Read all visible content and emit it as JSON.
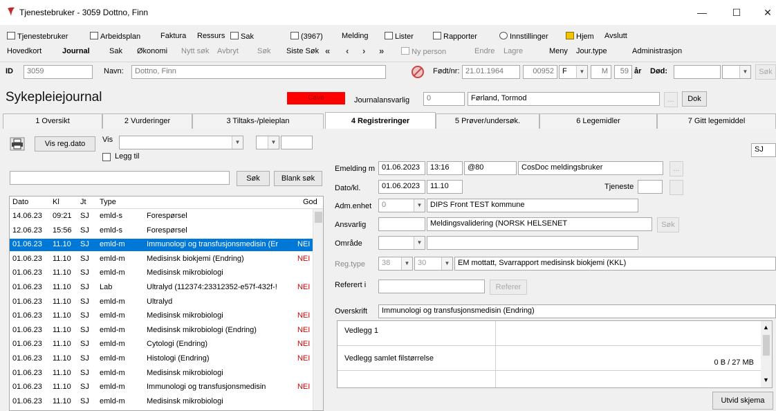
{
  "window": {
    "title": "Tjenestebruker - 3059 Dottno, Finn",
    "minimize": "—",
    "maximize": "☐",
    "close": "✕"
  },
  "menu": {
    "row1": [
      "Tjenestebruker",
      "Arbeidsplan",
      "Faktura",
      "Ressurs",
      "Sak",
      "(3967)",
      "Melding",
      "Lister",
      "Rapporter",
      "Innstillinger",
      "Hjem",
      "Avslutt"
    ],
    "row2": [
      "Hovedkort",
      "Journal",
      "Sak",
      "Økonomi",
      "Nytt søk",
      "Avbryt",
      "Søk",
      "Siste Søk",
      "Ny person",
      "Endre",
      "Lagre",
      "Meny",
      "Jour.type",
      "Administrasjon"
    ],
    "nav": [
      "«",
      "‹",
      "›",
      "»"
    ]
  },
  "person": {
    "id_label": "ID",
    "id_value": "3059",
    "name_label": "Navn:",
    "name_value": "Dottno, Finn",
    "fodt_label": "Født/nr:",
    "fodt_date": "21.01.1964",
    "fodt_nr": "00952",
    "kjonn": "F",
    "m": "M",
    "alder": "59",
    "ar_label": "år",
    "dod_label": "Død:",
    "sok_label": "Søk"
  },
  "journal": {
    "heading": "Sykepleiejournal",
    "cave": "Cave",
    "ansvarlig_label": "Journalansvarlig",
    "ansvarlig_id": "0",
    "ansvarlig_name": "Førland, Tormod",
    "ellipsis": "...",
    "dok": "Dok"
  },
  "tabs": [
    {
      "label": "1 Oversikt"
    },
    {
      "label": "2 Vurderinger"
    },
    {
      "label": "3 Tiltaks-/pleieplan"
    },
    {
      "label": "4 Registreringer"
    },
    {
      "label": "5 Prøver/undersøk."
    },
    {
      "label": "6 Legemidler"
    },
    {
      "label": "7 Gitt legemiddel"
    }
  ],
  "left": {
    "vis_reg_dato": "Vis reg.dato",
    "vis_label": "Vis",
    "legg_til": "Legg til",
    "sok": "Søk",
    "blank_sok": "Blank søk",
    "columns": [
      "Dato",
      "Kl",
      "Jt",
      "Type",
      "",
      "God"
    ],
    "rows": [
      {
        "dato": "14.06.23",
        "kl": "09:21",
        "jt": "SJ",
        "type": "emld-s",
        "desc": "Forespørsel",
        "nei": ""
      },
      {
        "dato": "12.06.23",
        "kl": "15:56",
        "jt": "SJ",
        "type": "emld-s",
        "desc": "Forespørsel",
        "nei": ""
      },
      {
        "dato": "01.06.23",
        "kl": "11.10",
        "jt": "SJ",
        "type": "emld-m",
        "desc": "Immunologi og transfusjonsmedisin (Er",
        "nei": "NEI"
      },
      {
        "dato": "01.06.23",
        "kl": "11.10",
        "jt": "SJ",
        "type": "emld-m",
        "desc": "Medisinsk biokjemi (Endring)",
        "nei": "NEI"
      },
      {
        "dato": "01.06.23",
        "kl": "11.10",
        "jt": "SJ",
        "type": "emld-m",
        "desc": "Medisinsk mikrobiologi",
        "nei": ""
      },
      {
        "dato": "01.06.23",
        "kl": "11.10",
        "jt": "SJ",
        "type": "Lab",
        "desc": "Ultralyd (112374:23312352-e57f-432f-!",
        "nei": "NEI"
      },
      {
        "dato": "01.06.23",
        "kl": "11.10",
        "jt": "SJ",
        "type": "emld-m",
        "desc": "Ultralyd",
        "nei": ""
      },
      {
        "dato": "01.06.23",
        "kl": "11.10",
        "jt": "SJ",
        "type": "emld-m",
        "desc": "Medisinsk mikrobiologi",
        "nei": "NEI"
      },
      {
        "dato": "01.06.23",
        "kl": "11.10",
        "jt": "SJ",
        "type": "emld-m",
        "desc": "Medisinsk mikrobiologi (Endring)",
        "nei": "NEI"
      },
      {
        "dato": "01.06.23",
        "kl": "11.10",
        "jt": "SJ",
        "type": "emld-m",
        "desc": "Cytologi (Endring)",
        "nei": "NEI"
      },
      {
        "dato": "01.06.23",
        "kl": "11.10",
        "jt": "SJ",
        "type": "emld-m",
        "desc": "Histologi (Endring)",
        "nei": "NEI"
      },
      {
        "dato": "01.06.23",
        "kl": "11.10",
        "jt": "SJ",
        "type": "emld-m",
        "desc": "Medisinsk mikrobiologi",
        "nei": ""
      },
      {
        "dato": "01.06.23",
        "kl": "11.10",
        "jt": "SJ",
        "type": "emld-m",
        "desc": "Immunologi og transfusjonsmedisin",
        "nei": "NEI"
      },
      {
        "dato": "01.06.23",
        "kl": "11.10",
        "jt": "SJ",
        "type": "emld-m",
        "desc": "Medisinsk mikrobiologi",
        "nei": ""
      }
    ]
  },
  "right": {
    "sj": "SJ",
    "emelding_label": "Emelding m",
    "emelding_date": "01.06.2023",
    "emelding_time": "13:16",
    "emelding_code": "@80",
    "emelding_user": "CosDoc meldingsbruker",
    "datokl_label": "Dato/kl.",
    "dato": "01.06.2023",
    "kl": "11.10",
    "tjeneste_label": "Tjeneste",
    "admenhet_label": "Adm.enhet",
    "admenhet_id": "0",
    "admenhet_name": "DIPS Front TEST kommune",
    "ansvarlig_label": "Ansvarlig",
    "ansvarlig_value": "Meldingsvalidering (NORSK HELSENET",
    "sok": "Søk",
    "omrade_label": "Område",
    "regtype_label": "Reg.type",
    "regtype_a": "38",
    "regtype_b": "30",
    "regtype_name": "EM mottatt, Svarrapport medisinsk biokjemi (KKL)",
    "referert_label": "Referert i",
    "referer": "Referer",
    "overskrift_label": "Overskrift",
    "overskrift": "Immunologi og transfusjonsmedisin (Endring)",
    "vedlegg1": "Vedlegg 1",
    "vedlegg_samlet": "Vedlegg samlet filstørrelse",
    "vedlegg_size": "0 B / 27 MB",
    "utvid": "Utvid skjema"
  },
  "colors": {
    "selection": "#0078d7",
    "nei": "#e00000",
    "cave": "#ff0000"
  }
}
